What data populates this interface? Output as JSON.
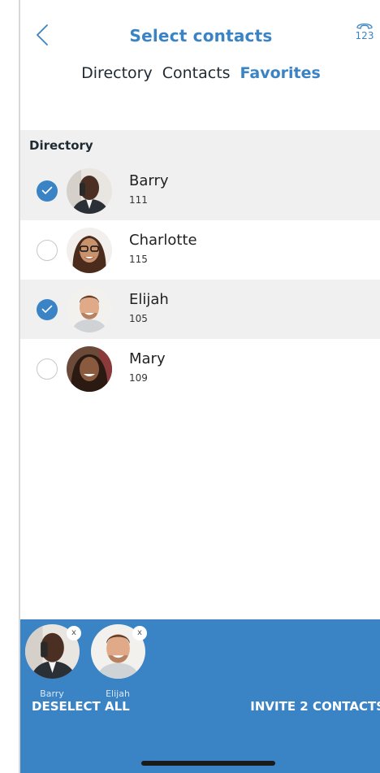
{
  "header": {
    "title": "Select contacts",
    "back_icon": "chevron-left-icon",
    "dialpad_icon": "phone-keypad-icon",
    "dialpad_label": "123"
  },
  "tabs": [
    {
      "label": "Directory",
      "active": false
    },
    {
      "label": "Contacts",
      "active": false
    },
    {
      "label": "Favorites",
      "active": true
    }
  ],
  "section": {
    "title": "Directory"
  },
  "contacts": [
    {
      "name": "Barry",
      "ext": "111",
      "selected": true
    },
    {
      "name": "Charlotte",
      "ext": "115",
      "selected": false
    },
    {
      "name": "Elijah",
      "ext": "105",
      "selected": true
    },
    {
      "name": "Mary",
      "ext": "109",
      "selected": false
    }
  ],
  "selection": {
    "chips": [
      {
        "name": "Barry",
        "remove_label": "x"
      },
      {
        "name": "Elijah",
        "remove_label": "x"
      }
    ],
    "deselect_label": "DESELECT ALL",
    "invite_label": "INVITE 2 CONTACTS"
  },
  "colors": {
    "accent": "#3a83c5",
    "row_selected_bg": "#f0f0f0",
    "section_bg": "#f0f0f0"
  }
}
